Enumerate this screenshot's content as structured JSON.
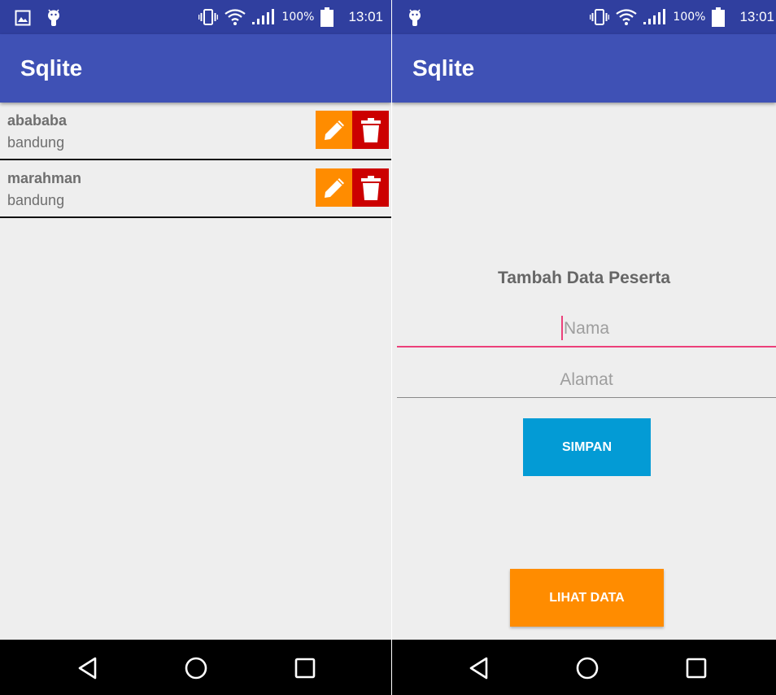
{
  "status_bar": {
    "battery_pct": "100%",
    "time": "13:01"
  },
  "app": {
    "title": "Sqlite"
  },
  "list_screen": {
    "items": [
      {
        "name": "abababa",
        "address": "bandung"
      },
      {
        "name": "marahman",
        "address": "bandung"
      }
    ],
    "icons": {
      "edit": "pencil-icon",
      "delete": "trash-icon"
    }
  },
  "form_screen": {
    "title": "Tambah Data Peserta",
    "nama_placeholder": "Nama",
    "alamat_placeholder": "Alamat",
    "simpan_label": "SIMPAN",
    "lihat_label": "LIHAT DATA"
  },
  "colors": {
    "status_bar": "#303f9f",
    "app_bar": "#3f51b5",
    "edit_button": "#ff8c00",
    "delete_button": "#cc0000",
    "simpan_button": "#039bd5",
    "lihat_button": "#ff8c00",
    "accent": "#ec407a"
  }
}
